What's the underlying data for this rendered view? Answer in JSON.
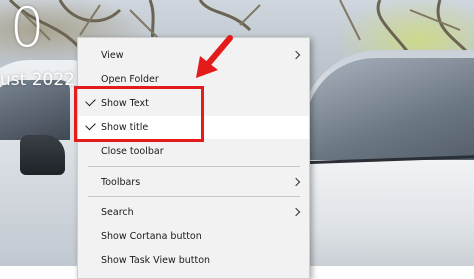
{
  "desktop": {
    "clock_hour": "0",
    "clock_date": "ust 2022"
  },
  "context_menu": {
    "items": [
      {
        "label": "View",
        "checked": false,
        "submenu": true
      },
      {
        "label": "Open Folder",
        "checked": false,
        "submenu": false
      },
      {
        "label": "Show Text",
        "checked": true,
        "submenu": false
      },
      {
        "label": "Show title",
        "checked": true,
        "submenu": false,
        "highlighted": true
      },
      {
        "label": "Close toolbar",
        "checked": false,
        "submenu": false
      },
      {
        "label": "Toolbars",
        "checked": false,
        "submenu": true
      },
      {
        "label": "Search",
        "checked": false,
        "submenu": true
      },
      {
        "label": "Show Cortana button",
        "checked": false,
        "submenu": false
      },
      {
        "label": "Show Task View button",
        "checked": false,
        "submenu": false
      }
    ]
  },
  "annotation": {
    "color": "#e41b1b",
    "icon": "red-arrow-icon"
  }
}
